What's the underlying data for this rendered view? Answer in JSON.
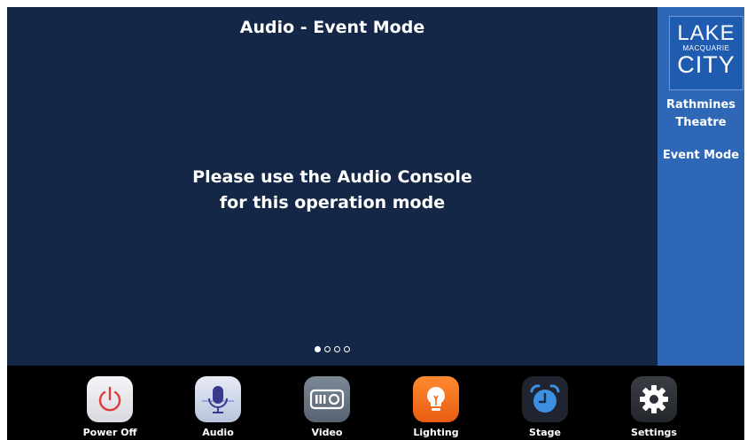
{
  "header": {
    "title": "Audio - Event Mode"
  },
  "main": {
    "message_line1": "Please use the Audio Console",
    "message_line2": "for this operation mode",
    "pager": {
      "count": 4,
      "active_index": 0
    }
  },
  "sidebar": {
    "logo": {
      "line1": "LAKE",
      "line2": "MACQUARIE",
      "line3": "CITY"
    },
    "venue_line1": "Rathmines",
    "venue_line2": "Theatre",
    "mode": "Event Mode"
  },
  "nav": {
    "items": [
      {
        "label": "Power Off",
        "icon": "power-icon"
      },
      {
        "label": "Audio",
        "icon": "microphone-icon"
      },
      {
        "label": "Video",
        "icon": "projector-icon"
      },
      {
        "label": "Lighting",
        "icon": "lightbulb-icon"
      },
      {
        "label": "Stage",
        "icon": "alarm-clock-icon"
      },
      {
        "label": "Settings",
        "icon": "gear-icon"
      }
    ]
  },
  "colors": {
    "main_bg": "#152746",
    "sidebar_bg": "#2f67b7",
    "nav_bg": "#000000",
    "power_red": "#e23a3a",
    "lighting_orange": "#f36f1c",
    "stage_blue": "#3d8fe0"
  }
}
